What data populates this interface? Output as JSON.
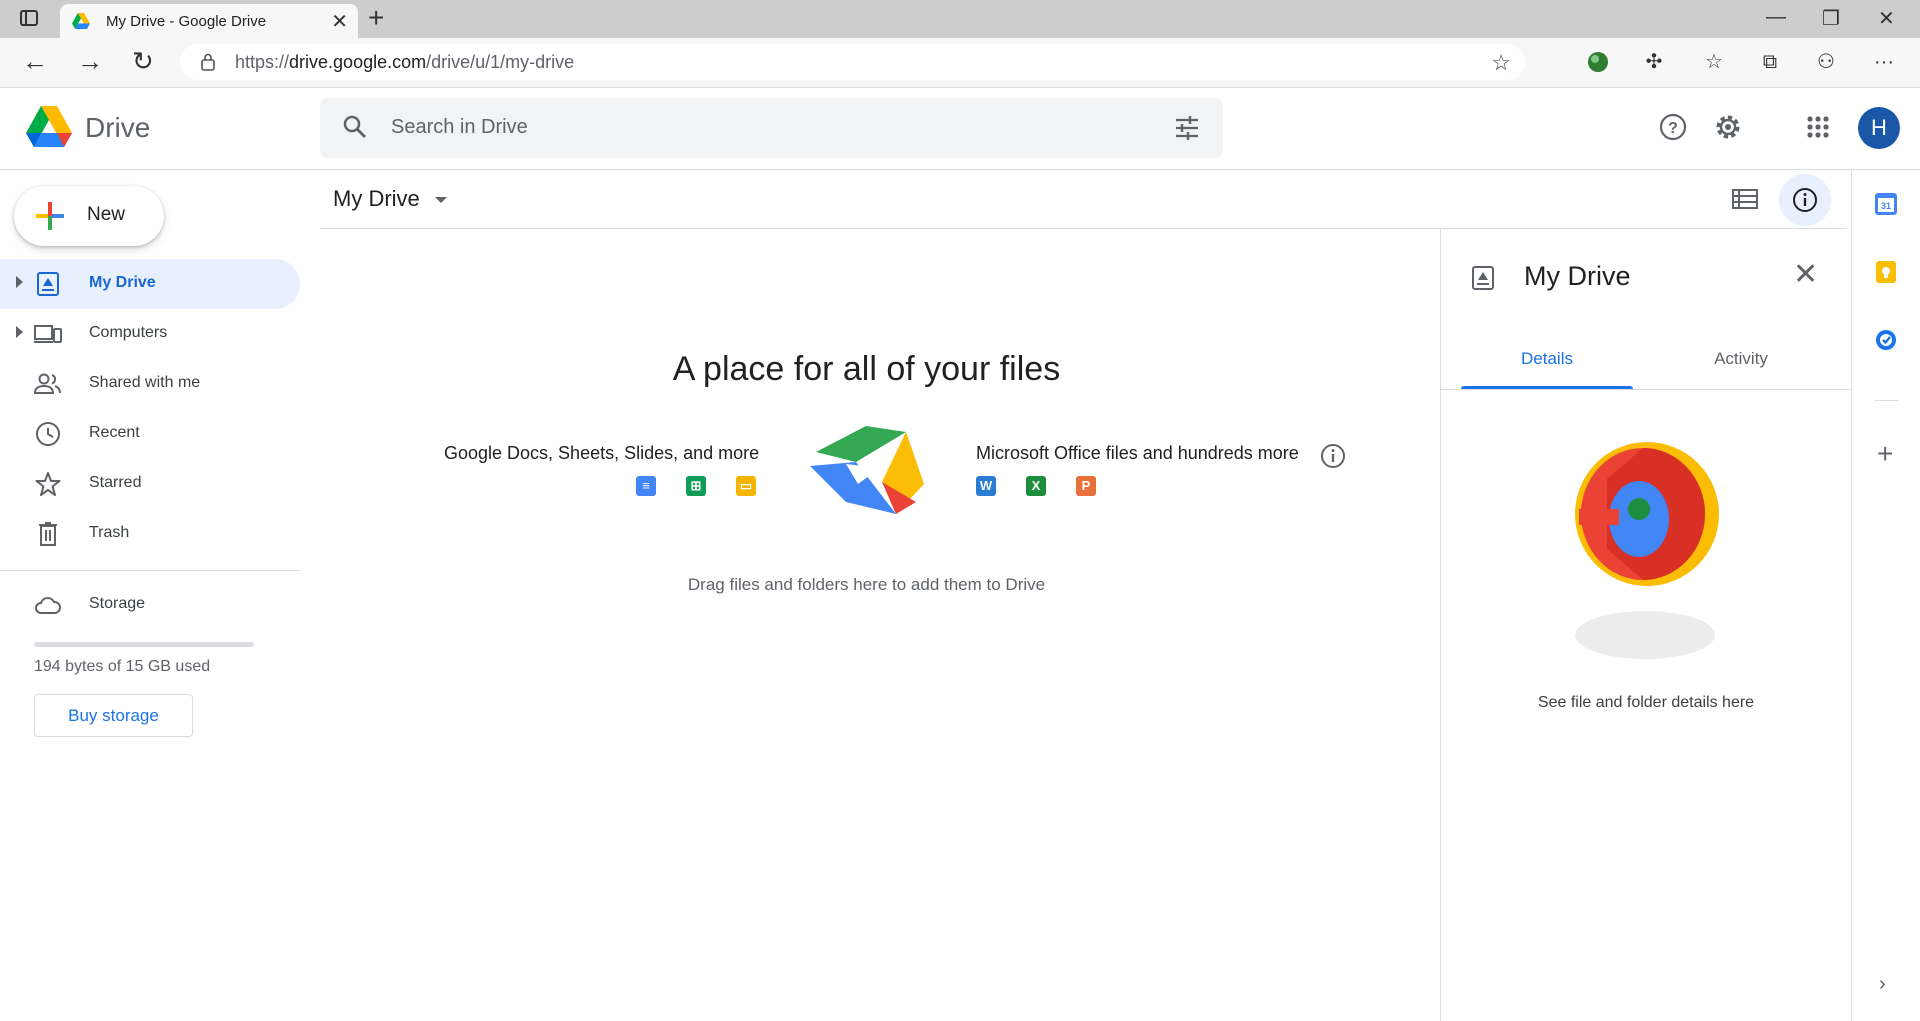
{
  "browser": {
    "tab_title": "My Drive - Google Drive",
    "url_prefix": "https://",
    "url_host": "drive.google.com",
    "url_path": "/drive/u/1/my-drive"
  },
  "header": {
    "product_name": "Drive",
    "search_placeholder": "Search in Drive",
    "avatar_initial": "H"
  },
  "sidebar": {
    "new_label": "New",
    "items": [
      {
        "label": "My Drive",
        "icon": "my-drive-icon",
        "active": true,
        "expandable": true
      },
      {
        "label": "Computers",
        "icon": "computers-icon",
        "active": false,
        "expandable": true
      },
      {
        "label": "Shared with me",
        "icon": "shared-icon",
        "active": false,
        "expandable": false
      },
      {
        "label": "Recent",
        "icon": "recent-icon",
        "active": false,
        "expandable": false
      },
      {
        "label": "Starred",
        "icon": "star-icon",
        "active": false,
        "expandable": false
      },
      {
        "label": "Trash",
        "icon": "trash-icon",
        "active": false,
        "expandable": false
      }
    ],
    "storage_label": "Storage",
    "storage_used_text": "194 bytes of 15 GB used",
    "buy_storage_label": "Buy storage"
  },
  "main": {
    "title": "My Drive",
    "empty_title": "A place for all of your files",
    "left_caption": "Google Docs, Sheets, Slides, and more",
    "right_caption": "Microsoft Office files and hundreds more",
    "drag_hint": "Drag files and folders here to add them to Drive",
    "office_letters": [
      "W",
      "X",
      "P"
    ]
  },
  "details_panel": {
    "title": "My Drive",
    "tabs": [
      "Details",
      "Activity"
    ],
    "active_tab": "Details",
    "message": "See file and folder details here"
  },
  "colors": {
    "accent": "#1a73e8",
    "active_bg": "#e8f0fe",
    "avatar": "#1a57a8"
  }
}
